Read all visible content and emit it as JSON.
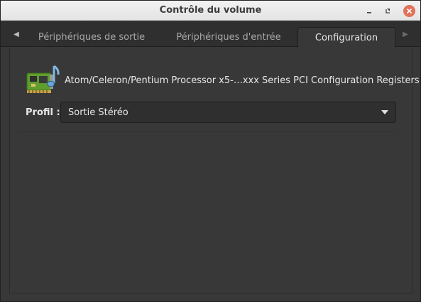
{
  "window": {
    "title": "Contrôle du volume"
  },
  "tabs": [
    {
      "label": "Périphériques de sortie",
      "selected": false
    },
    {
      "label": "Périphériques d'entrée",
      "selected": false
    },
    {
      "label": "Configuration",
      "selected": true
    }
  ],
  "configuration": {
    "device_name": "Atom/Celeron/Pentium Processor x5-…xxx Series PCI Configuration Registers",
    "device_icon": "audio-card-icon",
    "profile_label": "Profil :",
    "profile_value": "Sortie Stéréo"
  },
  "colors": {
    "close_button": "#e2725a",
    "window_bg": "#383838",
    "titlebar_bg": "#ececec"
  }
}
